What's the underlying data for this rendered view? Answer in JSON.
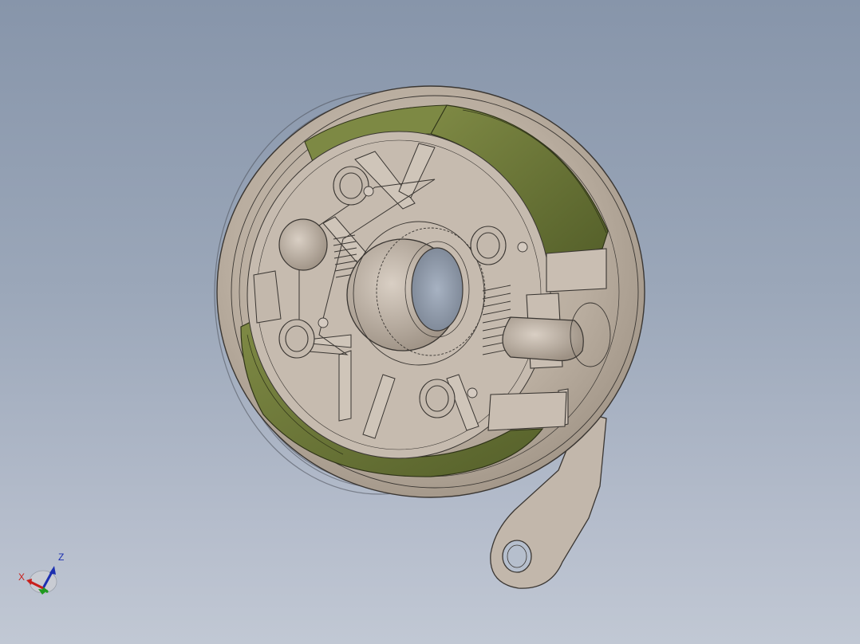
{
  "viewport": {
    "background_top": "#8795aa",
    "background_bottom": "#c1c8d4"
  },
  "model": {
    "part_color": "#bcb1a5",
    "lining_color": "#6b7636",
    "edge_color": "#3a3632"
  },
  "triad": {
    "x_label": "X",
    "z_label": "Z",
    "x_color": "#c8201c",
    "y_color": "#1f9a1f",
    "z_color": "#1c2fb0"
  }
}
